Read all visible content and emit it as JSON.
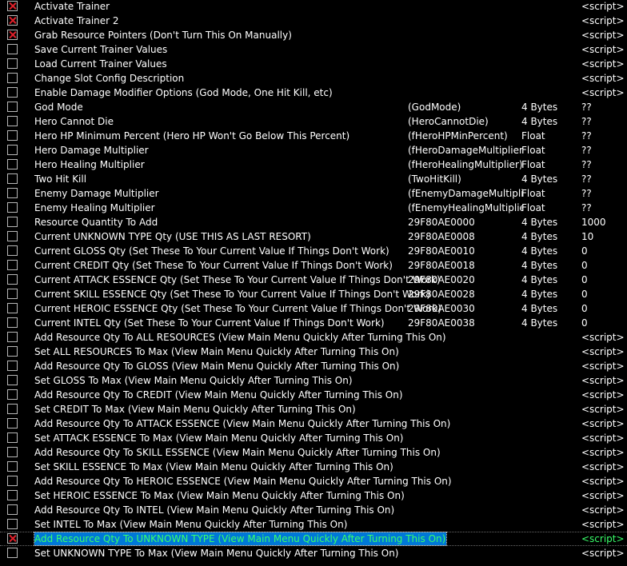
{
  "colors": {
    "background": "#000000",
    "text": "#ffffff",
    "check_mark": "#e0202a",
    "selection_bg": "#0078d7",
    "selection_text": "#39ff6a"
  },
  "rows": [
    {
      "description": "Activate Trainer",
      "address": "",
      "type": "",
      "value": "<script>",
      "checked": true
    },
    {
      "description": "Activate Trainer 2",
      "address": "",
      "type": "",
      "value": "<script>",
      "checked": true
    },
    {
      "description": "Grab Resource Pointers (Don't Turn This On Manually)",
      "address": "",
      "type": "",
      "value": "<script>",
      "checked": true
    },
    {
      "description": "Save Current Trainer Values",
      "address": "",
      "type": "",
      "value": "<script>",
      "checked": false
    },
    {
      "description": "Load Current Trainer Values",
      "address": "",
      "type": "",
      "value": "<script>",
      "checked": false
    },
    {
      "description": "Change Slot Config Description",
      "address": "",
      "type": "",
      "value": "<script>",
      "checked": false
    },
    {
      "description": "Enable Damage Modifier Options (God Mode, One Hit Kill, etc)",
      "address": "",
      "type": "",
      "value": "<script>",
      "checked": false
    },
    {
      "description": "God Mode",
      "address": "(GodMode)",
      "type": "4 Bytes",
      "value": "??",
      "checked": false
    },
    {
      "description": "Hero Cannot Die",
      "address": "(HeroCannotDie)",
      "type": "4 Bytes",
      "value": "??",
      "checked": false
    },
    {
      "description": "Hero HP Minimum Percent (Hero HP Won't Go Below This Percent)",
      "address": "(fHeroHPMinPercent)",
      "type": "Float",
      "value": "??",
      "checked": false
    },
    {
      "description": "Hero Damage Multiplier",
      "address": "(fHeroDamageMultiplier)",
      "type": "Float",
      "value": "??",
      "checked": false
    },
    {
      "description": "Hero Healing Multiplier",
      "address": "(fHeroHealingMultiplier)",
      "type": "Float",
      "value": "??",
      "checked": false
    },
    {
      "description": "Two Hit Kill",
      "address": "(TwoHitKill)",
      "type": "4 Bytes",
      "value": "??",
      "checked": false
    },
    {
      "description": "Enemy Damage Multiplier",
      "address": "(fEnemyDamageMultiplier)",
      "type": "Float",
      "value": "??",
      "checked": false
    },
    {
      "description": "Enemy Healing Multiplier",
      "address": "(fEnemyHealingMultiplier)",
      "type": "Float",
      "value": "??",
      "checked": false
    },
    {
      "description": "Resource Quantity To Add",
      "address": "29F80AE0000",
      "type": "4 Bytes",
      "value": "1000",
      "checked": false
    },
    {
      "description": "Current UNKNOWN TYPE Qty (USE THIS AS LAST RESORT)",
      "address": "29F80AE0008",
      "type": "4 Bytes",
      "value": "10",
      "checked": false
    },
    {
      "description": "Current GLOSS Qty (Set These To Your Current Value If Things Don't Work)",
      "address": "29F80AE0010",
      "type": "4 Bytes",
      "value": "0",
      "checked": false
    },
    {
      "description": "Current CREDIT Qty (Set These To Your Current Value If Things Don't Work)",
      "address": "29F80AE0018",
      "type": "4 Bytes",
      "value": "0",
      "checked": false
    },
    {
      "description": "Current ATTACK ESSENCE Qty (Set These To Your Current Value If Things Don't Work)",
      "address": "29F80AE0020",
      "type": "4 Bytes",
      "value": "0",
      "checked": false
    },
    {
      "description": "Current SKILL ESSENCE Qty (Set These To Your Current Value If Things Don't Work)",
      "address": "29F80AE0028",
      "type": "4 Bytes",
      "value": "0",
      "checked": false
    },
    {
      "description": "Current HEROIC ESSENCE Qty (Set These To Your Current Value If Things Don't Work)",
      "address": "29F80AE0030",
      "type": "4 Bytes",
      "value": "0",
      "checked": false
    },
    {
      "description": "Current INTEL Qty (Set These To Your Current Value If Things Don't Work)",
      "address": "29F80AE0038",
      "type": "4 Bytes",
      "value": "0",
      "checked": false
    },
    {
      "description": "Add Resource Qty To ALL RESOURCES (View Main Menu Quickly After Turning This On)",
      "address": "",
      "type": "",
      "value": "<script>",
      "checked": false
    },
    {
      "description": "Set ALL RESOURCES To Max (View Main Menu Quickly After Turning This On)",
      "address": "",
      "type": "",
      "value": "<script>",
      "checked": false
    },
    {
      "description": "Add Resource Qty To GLOSS (View Main Menu Quickly After Turning This On)",
      "address": "",
      "type": "",
      "value": "<script>",
      "checked": false
    },
    {
      "description": "Set GLOSS To Max (View Main Menu Quickly After Turning This On)",
      "address": "",
      "type": "",
      "value": "<script>",
      "checked": false
    },
    {
      "description": "Add Resource Qty To CREDIT (View Main Menu Quickly After Turning This On)",
      "address": "",
      "type": "",
      "value": "<script>",
      "checked": false
    },
    {
      "description": "Set CREDIT To Max (View Main Menu Quickly After Turning This On)",
      "address": "",
      "type": "",
      "value": "<script>",
      "checked": false
    },
    {
      "description": "Add Resource Qty To ATTACK ESSENCE (View Main Menu Quickly After Turning This On)",
      "address": "",
      "type": "",
      "value": "<script>",
      "checked": false
    },
    {
      "description": "Set ATTACK ESSENCE To Max (View Main Menu Quickly After Turning This On)",
      "address": "",
      "type": "",
      "value": "<script>",
      "checked": false
    },
    {
      "description": "Add Resource Qty To SKILL ESSENCE (View Main Menu Quickly After Turning This On)",
      "address": "",
      "type": "",
      "value": "<script>",
      "checked": false
    },
    {
      "description": "Set SKILL ESSENCE To Max (View Main Menu Quickly After Turning This On)",
      "address": "",
      "type": "",
      "value": "<script>",
      "checked": false
    },
    {
      "description": "Add Resource Qty To HEROIC ESSENCE (View Main Menu Quickly After Turning This On)",
      "address": "",
      "type": "",
      "value": "<script>",
      "checked": false
    },
    {
      "description": "Set HEROIC ESSENCE To Max (View Main Menu Quickly After Turning This On)",
      "address": "",
      "type": "",
      "value": "<script>",
      "checked": false
    },
    {
      "description": "Add Resource Qty To INTEL (View Main Menu Quickly After Turning This On)",
      "address": "",
      "type": "",
      "value": "<script>",
      "checked": false
    },
    {
      "description": "Set INTEL To Max (View Main Menu Quickly After Turning This On)",
      "address": "",
      "type": "",
      "value": "<script>",
      "checked": false
    },
    {
      "description": "Add Resource Qty To UNKNOWN TYPE (View Main Menu Quickly After Turning This On)",
      "address": "",
      "type": "",
      "value": "<script>",
      "checked": true,
      "selected": true
    },
    {
      "description": "Set UNKNOWN TYPE To Max (View Main Menu Quickly After Turning This On)",
      "address": "",
      "type": "",
      "value": "<script>",
      "checked": false
    }
  ]
}
